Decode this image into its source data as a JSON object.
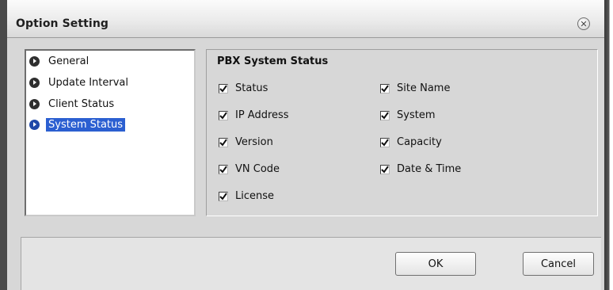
{
  "dialog": {
    "title": "Option Setting",
    "close_icon": "close-icon"
  },
  "sidebar": {
    "items": [
      {
        "label": "General",
        "selected": false
      },
      {
        "label": "Update Interval",
        "selected": false
      },
      {
        "label": "Client Status",
        "selected": false
      },
      {
        "label": "System Status",
        "selected": true
      }
    ]
  },
  "panel": {
    "title": "PBX System Status",
    "checkboxes": [
      {
        "label": "Status",
        "checked": true
      },
      {
        "label": "IP Address",
        "checked": true
      },
      {
        "label": "Version",
        "checked": true
      },
      {
        "label": "VN Code",
        "checked": true
      },
      {
        "label": "License",
        "checked": true
      },
      {
        "label": "Site Name",
        "checked": true
      },
      {
        "label": "System",
        "checked": true
      },
      {
        "label": "Capacity",
        "checked": true
      },
      {
        "label": "Date & Time",
        "checked": true
      }
    ]
  },
  "buttons": {
    "ok": "OK",
    "cancel": "Cancel"
  },
  "colors": {
    "selection": "#2b5fd1",
    "dialog_bg": "#d7d7d7"
  }
}
